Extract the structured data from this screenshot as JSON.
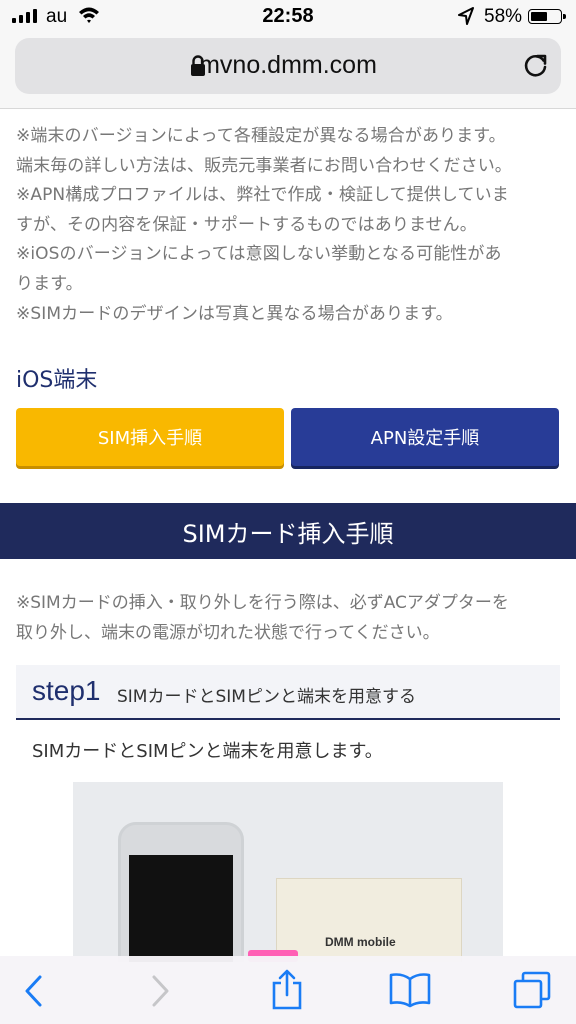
{
  "status": {
    "carrier": "au",
    "time": "22:58",
    "battery_percent": "58%",
    "battery_level": 0.58
  },
  "browser": {
    "url": "mvno.dmm.com"
  },
  "notes": [
    "※端末のバージョンによって各種設定が異なる場合があります。",
    "端末毎の詳しい方法は、販売元事業者にお問い合わせください。",
    "※APN構成プロファイルは、弊社で作成・検証して提供していま",
    "すが、その内容を保証・サポートするものではありません。",
    "※iOSのバージョンによっては意図しない挙動となる可能性があ",
    "ります。",
    "※SIMカードのデザインは写真と異なる場合があります。"
  ],
  "ios_section": {
    "heading": "iOS端末",
    "sim_button": "SIM挿入手順",
    "apn_button": "APN設定手順"
  },
  "sim_section": {
    "title": "SIMカード挿入手順",
    "notice": [
      "※SIMカードの挿入・取り外しを行う際は、必ずACアダプターを",
      "取り外し、端末の電源が切れた状態で行ってください。"
    ],
    "step": {
      "number": "step1",
      "title": "SIMカードとSIMピンと端末を用意する",
      "body": "SIMカードとSIMピンと端末を用意します。"
    },
    "photo_logo": "DMM mobile"
  },
  "icons": {
    "back": "chevron-left-icon",
    "forward": "chevron-right-icon",
    "share": "share-icon",
    "bookmarks": "book-icon",
    "tabs": "tabs-icon"
  },
  "colors": {
    "accent_yellow": "#f9b800",
    "accent_navy": "#283c97",
    "band_navy": "#1f2a5c"
  }
}
